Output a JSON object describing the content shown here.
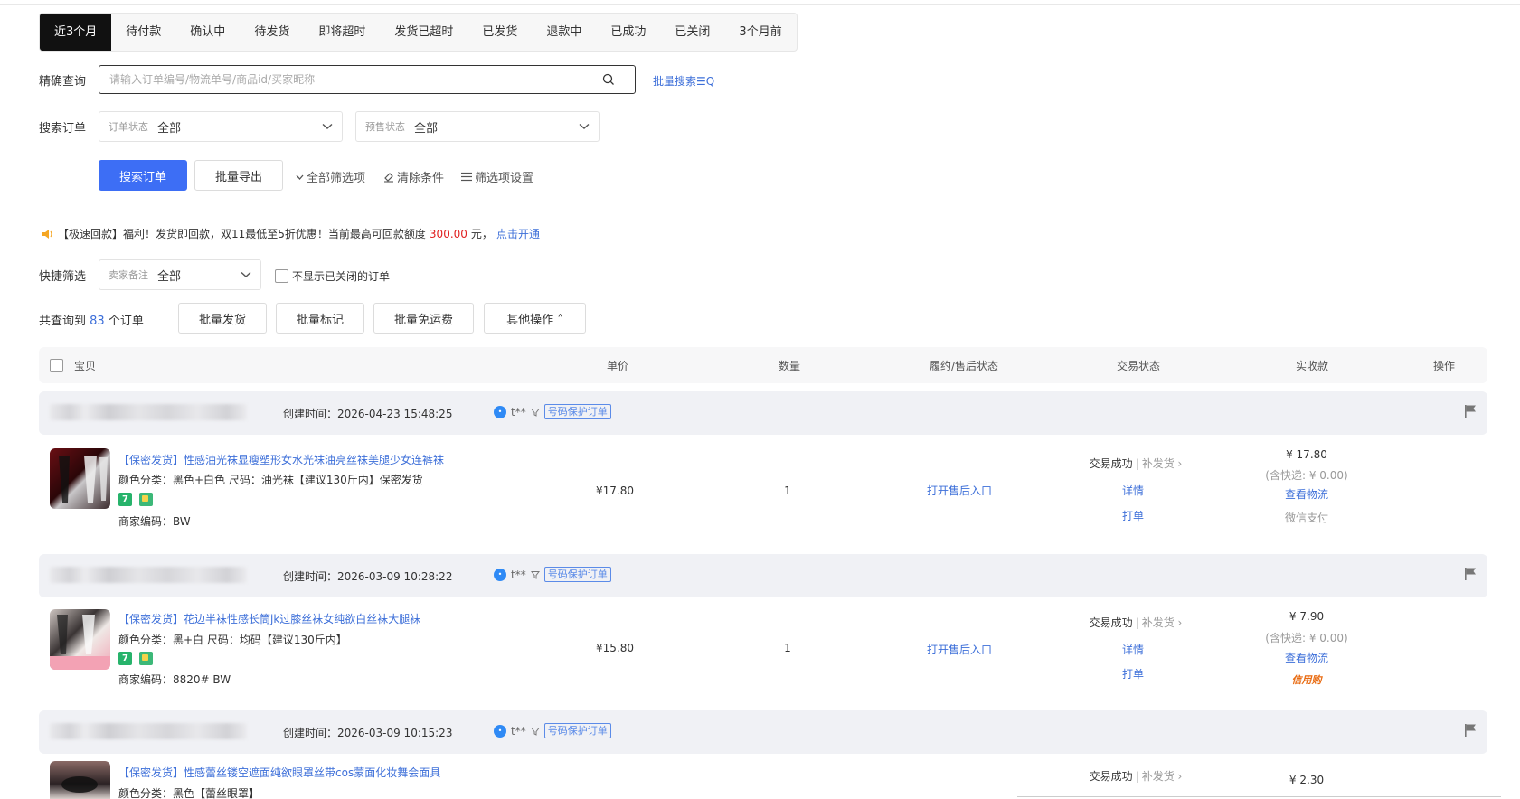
{
  "tabs": [
    "近3个月",
    "待付款",
    "确认中",
    "待发货",
    "即将超时",
    "发货已超时",
    "已发货",
    "退款中",
    "已成功",
    "已关闭",
    "3个月前"
  ],
  "precise": {
    "label": "精确查询",
    "placeholder": "请输入订单编号/物流单号/商品id/买家昵称",
    "batch_search": "批量搜索☰Q"
  },
  "search_order": {
    "label": "搜索订单",
    "order_status_label": "订单状态",
    "order_status_value": "全部",
    "presale_label": "预售状态",
    "presale_value": "全部"
  },
  "actions": {
    "search": "搜索订单",
    "export": "批量导出",
    "all_filters": "全部筛选项",
    "clear": "清除条件",
    "filter_settings": "筛选项设置"
  },
  "notice": {
    "prefix": "【极速回款】福利！发货即回款，双11最低至5折优惠！当前最高可回款额度",
    "amount": "300.00",
    "suffix": "元，",
    "link": "点击开通"
  },
  "quick": {
    "label": "快捷筛选",
    "seller_note_label": "卖家备注",
    "seller_note_value": "全部",
    "hide_closed": "不显示已关闭的订单"
  },
  "summary": {
    "prefix": "共查询到",
    "count": "83",
    "suffix": "个订单"
  },
  "batch_buttons": {
    "ship": "批量发货",
    "mark": "批量标记",
    "free_shipping": "批量免运费",
    "other": "其他操作 ˄"
  },
  "table_headers": {
    "item": "宝贝",
    "price": "单价",
    "qty": "数量",
    "after_sale": "履约/售后状态",
    "trade_status": "交易状态",
    "paid": "实收款",
    "op": "操作"
  },
  "orders": [
    {
      "created": "创建时间：2026-04-23 15:48:25",
      "buyer": "t**",
      "protect": "号码保护订单",
      "title": "【保密发货】性感油光袜显瘦塑形女水光袜油亮丝袜美腿少女连裤袜",
      "spec": "颜色分类：黑色+白色  尺码：油光袜【建议130斤内】保密发货",
      "code": "商家编码：BW",
      "price": "¥17.80",
      "qty": "1",
      "after_sale": "打开售后入口",
      "status": "交易成功",
      "resend": "补发货 ›",
      "detail": "详情",
      "print": "打单",
      "paid": "¥ 17.80",
      "shipping": "(含快递: ¥ 0.00)",
      "logistics": "查看物流",
      "pay_method": "微信支付"
    },
    {
      "created": "创建时间：2026-03-09 10:28:22",
      "buyer": "t**",
      "protect": "号码保护订单",
      "title": "【保密发货】花边半袜性感长筒jk过膝丝袜女纯欲白丝袜大腿袜",
      "spec": "颜色分类：黑+白  尺码：均码【建议130斤内】",
      "code": "商家编码：8820# BW",
      "price": "¥15.80",
      "qty": "1",
      "after_sale": "打开售后入口",
      "status": "交易成功",
      "resend": "补发货 ›",
      "detail": "详情",
      "print": "打单",
      "paid": "¥ 7.90",
      "shipping": "(含快递: ¥ 0.00)",
      "logistics": "查看物流",
      "pay_method": "信用购"
    },
    {
      "created": "创建时间：2026-03-09 10:15:23",
      "buyer": "t**",
      "protect": "号码保护订单",
      "title": "【保密发货】性感蕾丝镂空遮面纯欲眼罩丝带cos蒙面化妆舞会面具",
      "spec": "颜色分类：黑色【蕾丝眼罩】",
      "status": "交易成功",
      "resend": "补发货 ›",
      "paid": "¥ 2.30"
    }
  ],
  "colors": {
    "primary": "#3d6ef5",
    "link": "#3d6fd9",
    "active_tab": "#111111",
    "amount_red": "#e02020"
  }
}
